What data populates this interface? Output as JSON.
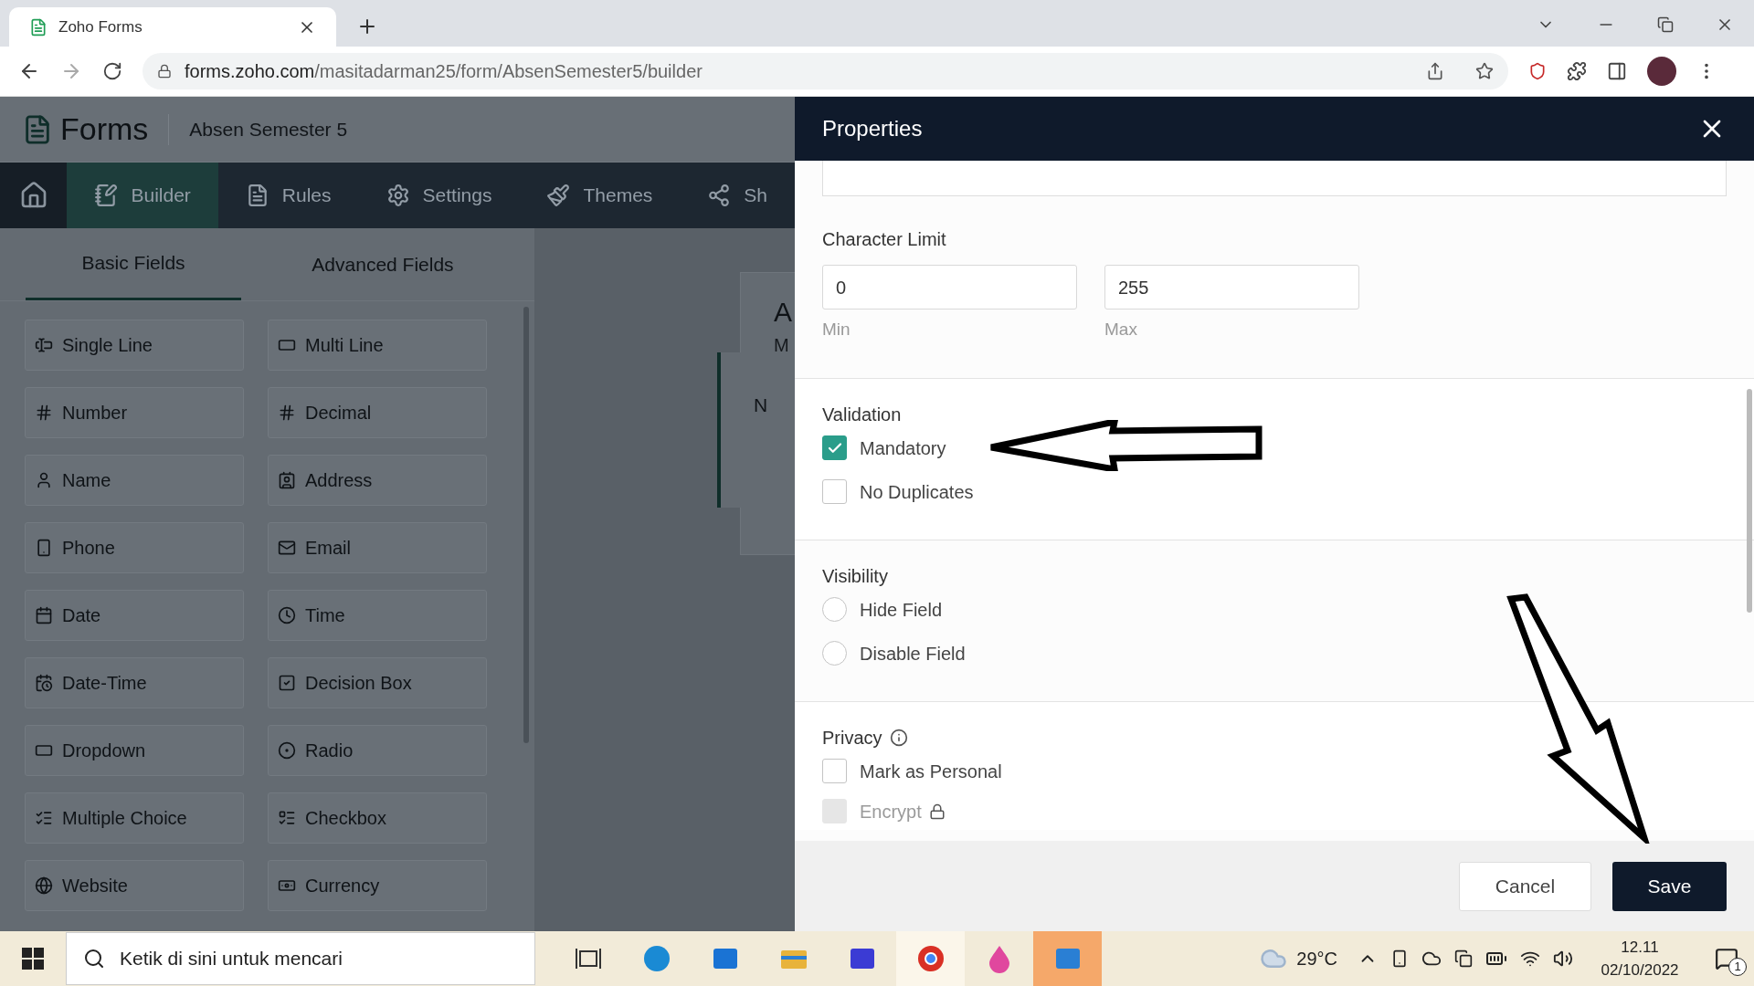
{
  "browser": {
    "tab_title": "Zoho Forms",
    "url_domain": "forms.zoho.com",
    "url_path": "/masitadarman25/form/AbsenSemester5/builder"
  },
  "app": {
    "logo": "Forms",
    "form_name": "Absen Semester 5",
    "nav": [
      {
        "kind": "home",
        "selected": false
      },
      {
        "kind": "builder",
        "label": "Builder",
        "selected": true
      },
      {
        "kind": "rules",
        "label": "Rules",
        "selected": false
      },
      {
        "kind": "settings",
        "label": "Settings",
        "selected": false
      },
      {
        "kind": "themes",
        "label": "Themes",
        "selected": false
      },
      {
        "kind": "share",
        "label": "Sh",
        "selected": false
      }
    ],
    "field_tabs": [
      {
        "label": "Basic Fields",
        "selected": true
      },
      {
        "label": "Advanced Fields",
        "selected": false
      }
    ],
    "fields": [
      {
        "kind": "singleline",
        "label": "Single Line"
      },
      {
        "kind": "multiline",
        "label": "Multi Line"
      },
      {
        "kind": "number",
        "label": "Number"
      },
      {
        "kind": "decimal",
        "label": "Decimal"
      },
      {
        "kind": "name",
        "label": "Name"
      },
      {
        "kind": "address",
        "label": "Address"
      },
      {
        "kind": "phone",
        "label": "Phone"
      },
      {
        "kind": "email",
        "label": "Email"
      },
      {
        "kind": "date",
        "label": "Date"
      },
      {
        "kind": "time",
        "label": "Time"
      },
      {
        "kind": "datetime",
        "label": "Date-Time"
      },
      {
        "kind": "decision",
        "label": "Decision Box"
      },
      {
        "kind": "dropdown",
        "label": "Dropdown"
      },
      {
        "kind": "radio",
        "label": "Radio"
      },
      {
        "kind": "multiple",
        "label": "Multiple Choice"
      },
      {
        "kind": "checkbox",
        "label": "Checkbox"
      },
      {
        "kind": "website",
        "label": "Website"
      },
      {
        "kind": "currency",
        "label": "Currency"
      }
    ],
    "canvas": {
      "title_fragment": "A",
      "subtitle_fragment": "M",
      "field_fragment": "N"
    }
  },
  "properties": {
    "title": "Properties",
    "character_limit": {
      "label": "Character Limit",
      "min": {
        "value": "0",
        "caption": "Min"
      },
      "max": {
        "value": "255",
        "caption": "Max"
      }
    },
    "validation": {
      "label": "Validation",
      "options": [
        {
          "label": "Mandatory",
          "checked": true
        },
        {
          "label": "No Duplicates",
          "checked": false
        }
      ]
    },
    "visibility": {
      "label": "Visibility",
      "options": [
        {
          "label": "Hide Field",
          "selected": false
        },
        {
          "label": "Disable Field",
          "selected": false
        }
      ]
    },
    "privacy": {
      "label": "Privacy",
      "options": [
        {
          "label": "Mark as Personal",
          "checked": false,
          "disabled": false
        },
        {
          "label": "Encrypt",
          "checked": false,
          "disabled": true
        }
      ]
    },
    "buttons": [
      {
        "kind": "secondary",
        "label": "Cancel"
      },
      {
        "kind": "primary",
        "label": "Save"
      }
    ]
  },
  "taskbar": {
    "search_placeholder": "Ketik di sini untuk mencari",
    "temperature": "29°C",
    "time": "12.11",
    "date": "02/10/2022",
    "notifications": "1"
  }
}
